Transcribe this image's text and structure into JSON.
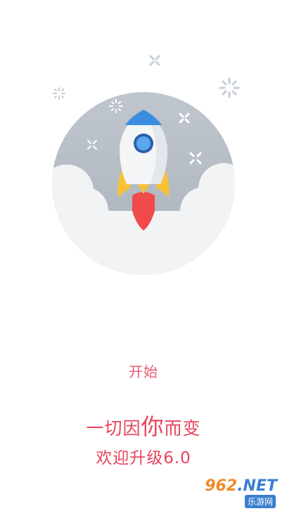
{
  "screen": {
    "start_label": "开始",
    "slogan_line1_before": "一切因",
    "slogan_line1_emphasis": "你",
    "slogan_line1_after": "而变",
    "slogan_line2": "欢迎升级6.0"
  },
  "watermark": {
    "top_number": "962",
    "top_suffix": ".NET",
    "bottom_text": "乐游网"
  },
  "illustration": {
    "icons": [
      "rocket-icon",
      "sparkle-icon",
      "cloud-icon"
    ]
  },
  "colors": {
    "accent": "#e8435c",
    "start": "#e85a74",
    "circle": "#b7bec7",
    "cloud": "#f1f3f5",
    "rocket_blue": "#3b8de0",
    "flame_red": "#f04a4a",
    "flame_yellow": "#f7c233"
  }
}
